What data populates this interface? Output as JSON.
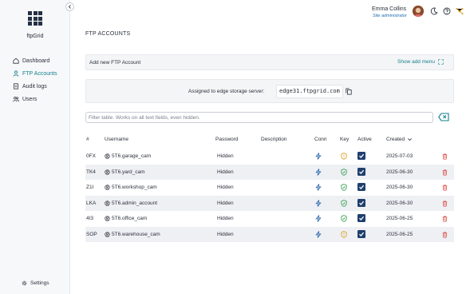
{
  "sidebar": {
    "brand": "ftpGrid",
    "nav": [
      {
        "label": "Dashboard",
        "icon": "dashboard-icon",
        "active": false
      },
      {
        "label": "FTP Accounts",
        "icon": "users-icon",
        "active": true
      },
      {
        "label": "Audit logs",
        "icon": "document-icon",
        "active": false
      },
      {
        "label": "Users",
        "icon": "group-icon",
        "active": false
      }
    ],
    "settings_label": "Settings"
  },
  "header": {
    "user_name": "Emma Collins",
    "user_role": "Site administrator"
  },
  "main": {
    "title": "FTP ACCOUNTS",
    "add_panel_label": "Add new FTP Account",
    "show_add_menu": "Show add menu",
    "server_label": "Assigned to edge storage server:",
    "server_value": "edge31.ftpgrid.com",
    "filter_placeholder": "Filter table. Works on all text fields, even hidden."
  },
  "table": {
    "columns": {
      "id": "#",
      "username": "Username",
      "password": "Password",
      "description": "Description",
      "conn": "Conn",
      "key": "Key",
      "active": "Active",
      "created": "Created"
    },
    "rows": [
      {
        "id": "0FX",
        "username": "5T6.garage_cam",
        "password": "Hidden",
        "description": "",
        "key_status": "warning",
        "active": true,
        "created": "2025-07-03"
      },
      {
        "id": "TK4",
        "username": "5T6.yard_cam",
        "password": "Hidden",
        "description": "",
        "key_status": "ok",
        "active": true,
        "created": "2025-06-30"
      },
      {
        "id": "Z1I",
        "username": "5T6.workshop_cam",
        "password": "Hidden",
        "description": "",
        "key_status": "ok",
        "active": true,
        "created": "2025-06-30"
      },
      {
        "id": "LKA",
        "username": "5T6.admin_account",
        "password": "Hidden",
        "description": "",
        "key_status": "ok",
        "active": true,
        "created": "2025-06-30"
      },
      {
        "id": "4I3",
        "username": "5T6.office_cam",
        "password": "Hidden",
        "description": "",
        "key_status": "ok",
        "active": true,
        "created": "2025-06-25"
      },
      {
        "id": "SOP",
        "username": "5T6.warehouse_cam",
        "password": "Hidden",
        "description": "",
        "key_status": "warning",
        "active": true,
        "created": "2025-06-25"
      }
    ]
  },
  "colors": {
    "accent": "#137f8c",
    "key_ok": "#2f9a4a",
    "key_warning": "#d99a16",
    "checkbox": "#1f3f6e",
    "delete": "#d9443a",
    "conn": "#1f5fa8"
  }
}
